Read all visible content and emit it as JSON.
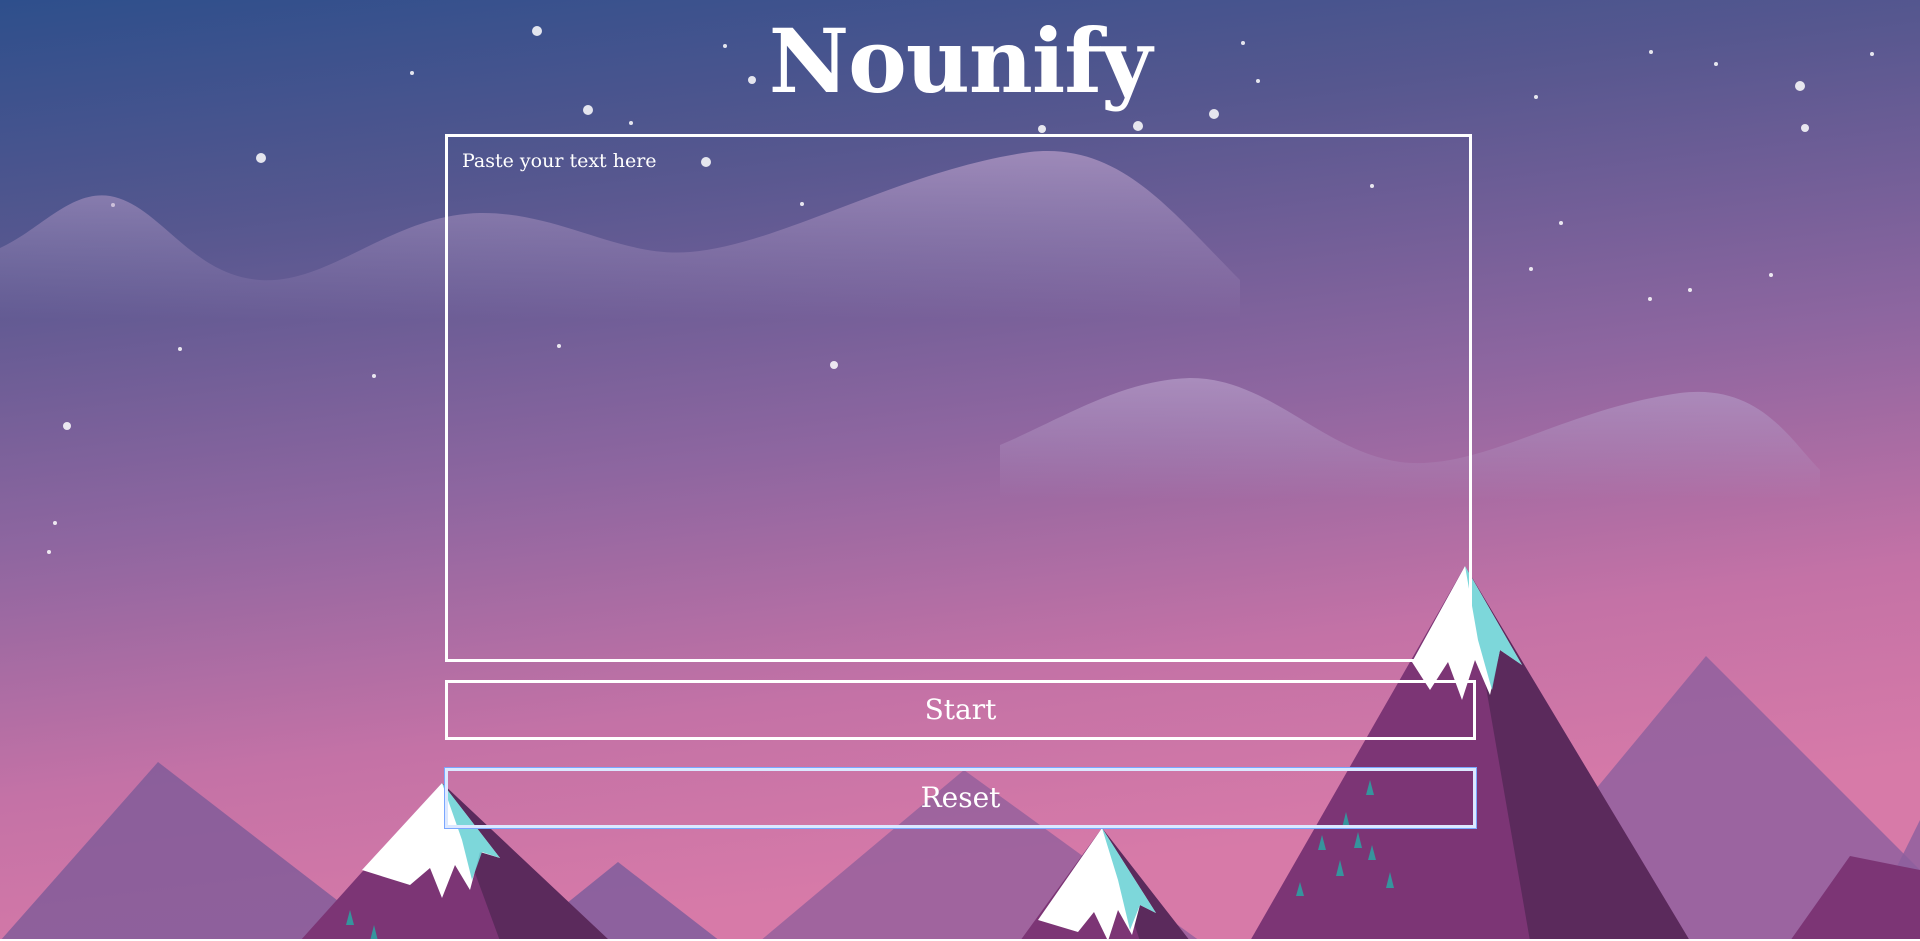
{
  "app": {
    "title": "Nounify"
  },
  "editor": {
    "placeholder": "Paste your text here",
    "value": ""
  },
  "actions": {
    "start_label": "Start",
    "reset_label": "Reset"
  },
  "theme": {
    "sky_top": "#2f4f8f",
    "sky_mid": "#8a64a0",
    "sky_bottom": "#d177a6",
    "snow": "#ffffff",
    "ice": "#6fd3d6",
    "mountain_dark": "#5a2a5a",
    "mountain_mid": "#7a3575",
    "mountain_far": "#8a5a9a",
    "button_border": "#ffffff"
  },
  "background": {
    "icon": "mountain-night-scene"
  }
}
